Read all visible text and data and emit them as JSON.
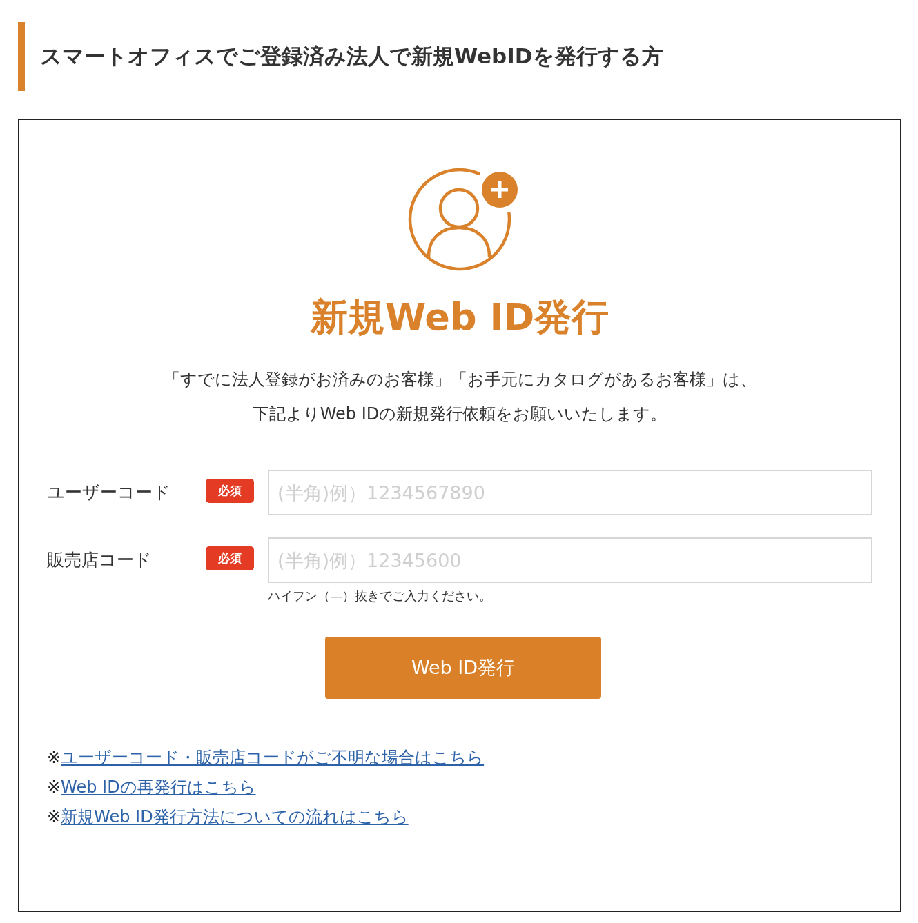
{
  "heading": "スマートオフィスでご登録済み法人で新規WebIDを発行する方",
  "card": {
    "title": "新規Web ID発行",
    "description": [
      "「すでに法人登録がお済みのお客様」「お手元にカタログがあるお客様」は、",
      "下記よりWeb IDの新規発行依頼をお願いいたします。"
    ],
    "fields": [
      {
        "label": "ユーザーコード",
        "badge": "必須",
        "placeholder": "(半角)例）1234567890"
      },
      {
        "label": "販売店コード",
        "badge": "必須",
        "placeholder": "(半角)例）12345600",
        "hint": "ハイフン（—）抜きでご入力ください。"
      }
    ],
    "submit": "Web ID発行",
    "links": [
      {
        "mark": "※",
        "text": "ユーザーコード・販売店コードがご不明な場合はこちら"
      },
      {
        "mark": "※",
        "text": "Web IDの再発行はこちら"
      },
      {
        "mark": "※",
        "text": "新規Web ID発行方法についての流れはこちら"
      }
    ]
  }
}
